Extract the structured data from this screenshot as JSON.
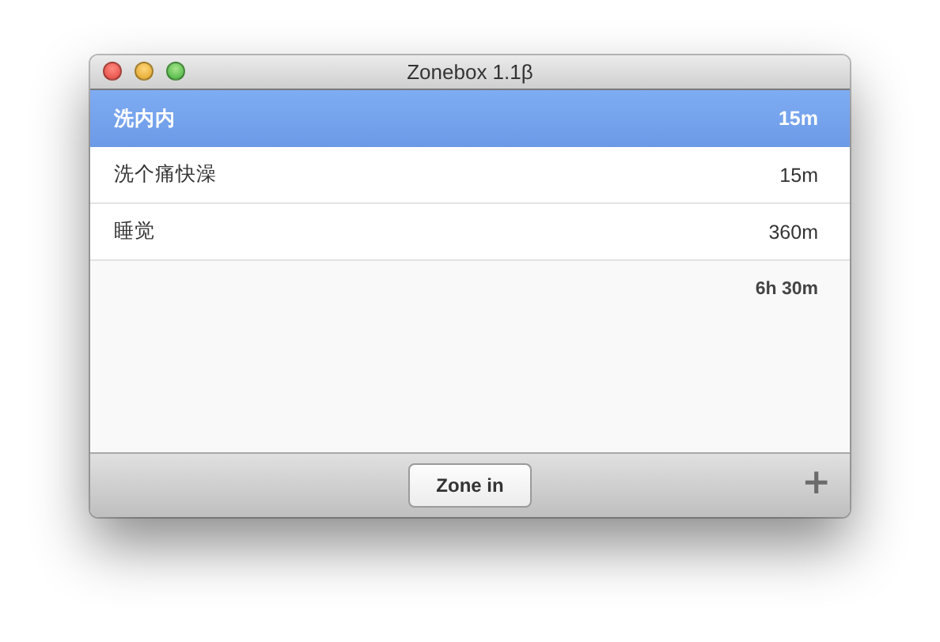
{
  "window": {
    "title": "Zonebox 1.1β"
  },
  "tasks": [
    {
      "name": "洗内内",
      "duration": "15m",
      "selected": true
    },
    {
      "name": "洗个痛快澡",
      "duration": "15m",
      "selected": false
    },
    {
      "name": "睡觉",
      "duration": "360m",
      "selected": false
    }
  ],
  "total": "6h 30m",
  "footer": {
    "button": "Zone in",
    "add": "+"
  }
}
